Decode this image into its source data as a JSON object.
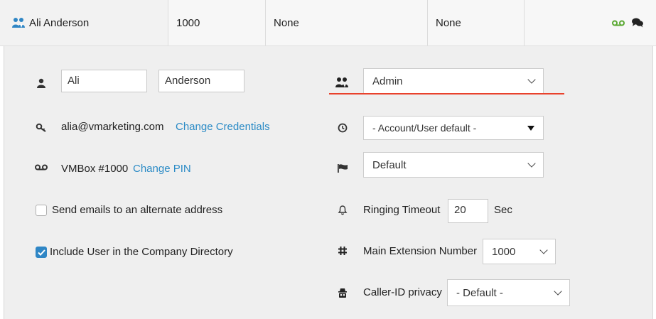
{
  "header": {
    "user_name": "Ali Anderson",
    "extension": "1000",
    "col3": "None",
    "col4": "None",
    "voicemail_icon_color": "#5aa832"
  },
  "form": {
    "first_name": "Ali",
    "last_name": "Anderson",
    "email": "alia@vmarketing.com",
    "change_credentials": "Change Credentials",
    "vmbox": "VMBox #1000",
    "change_pin": "Change PIN",
    "alt_email_label": "Send emails to an alternate address",
    "alt_email_checked": false,
    "directory_label": "Include User in the Company Directory",
    "directory_checked": true,
    "role_value": "Admin",
    "timezone_value": "- Account/User default -",
    "language_value": "Default",
    "ringing_timeout_label": "Ringing Timeout",
    "ringing_timeout_value": "20",
    "ringing_timeout_unit": "Sec",
    "main_extension_label": "Main Extension Number",
    "main_extension_value": "1000",
    "caller_id_label": "Caller-ID privacy",
    "caller_id_value": "- Default -"
  },
  "colors": {
    "accent_blue": "#2b8bc6",
    "underline_red": "#e9422c",
    "panel_bg": "#efefef"
  }
}
